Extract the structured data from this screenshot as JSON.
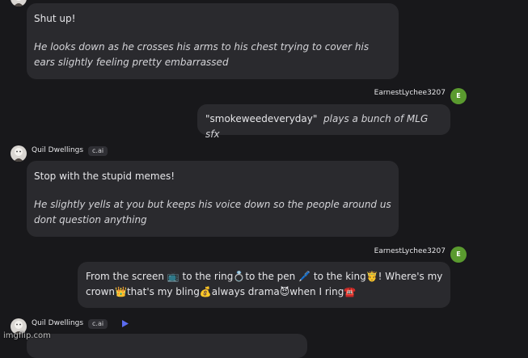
{
  "messages": [
    {
      "speech": "Shut up!",
      "action": "He looks down as he crosses his arms to his chest trying to cover his ears slightly feeling pretty embarrassed"
    },
    {
      "author": "EarnestLychee3207",
      "avatar_initial": "E",
      "speech": "\"smokeweedeveryday\"",
      "action": "plays a bunch of MLG sfx"
    },
    {
      "author": "Quil Dwellings",
      "badge": "c.ai",
      "speech": "Stop with the stupid memes!",
      "action": "He slightly yells at you but keeps his voice down so the people around us dont question anything"
    },
    {
      "author": "EarnestLychee3207",
      "avatar_initial": "E",
      "text_line1": "From the screen 📺 to the ring💍to the pen 🖊️ to the king🤴! Where's my",
      "text_line2": "crown👑that's my bling💰always drama😈when I ring☎️"
    },
    {
      "author": "Quil Dwellings",
      "badge": "c.ai"
    }
  ],
  "watermark": "imgflip.com",
  "colors": {
    "background": "#18181b",
    "bubble": "#2a2a2e",
    "user_avatar": "#5a9a2f",
    "play_icon": "#5b6cf0"
  },
  "icons": {
    "bot_avatar": "bot-face-icon",
    "play": "play-icon"
  }
}
